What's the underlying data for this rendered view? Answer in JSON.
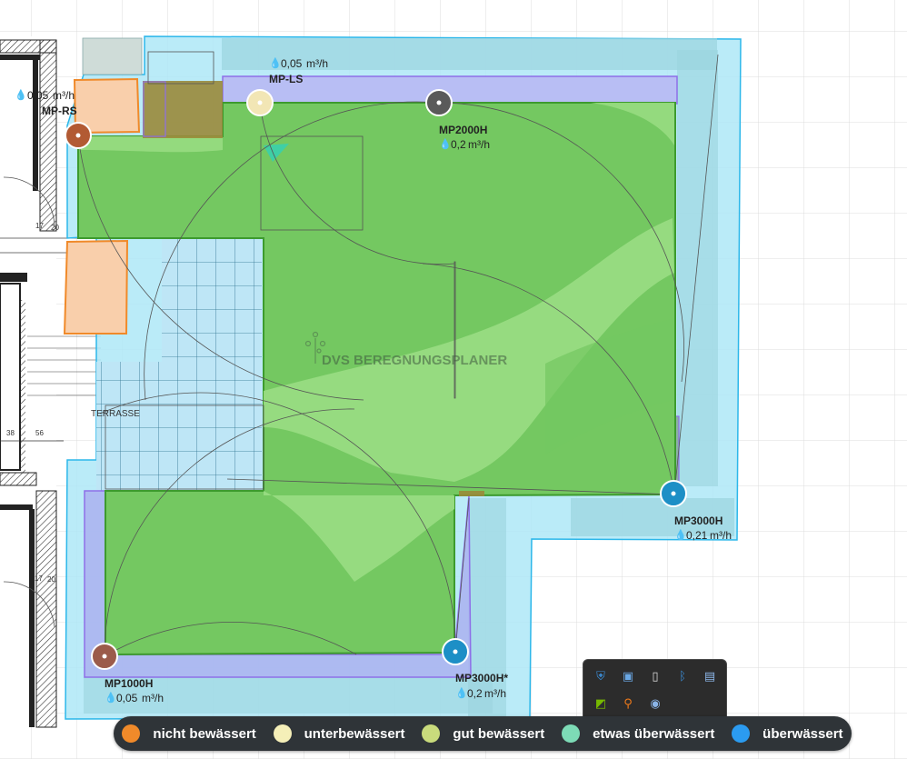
{
  "plan": {
    "watermark": "DVS BEREGNUNGSPLANER",
    "terrace_label": "TERRASSE",
    "dimension_labels": [
      "20",
      "17",
      "56",
      "38",
      "20",
      "17"
    ]
  },
  "sprinklers": [
    {
      "name": "MP-RS",
      "flow": "0,05",
      "unit": "m³/h",
      "color": "#b25a33"
    },
    {
      "name": "MP-LS",
      "flow": "0,05",
      "unit": "m³/h",
      "color": "#f2e6b5"
    },
    {
      "name": "MP2000H",
      "flow": "0,2",
      "unit": "m³/h",
      "color": "#5a5a5a"
    },
    {
      "name": "MP3000H",
      "flow": "0,21",
      "unit": "m³/h",
      "color": "#1d8fc6"
    },
    {
      "name": "MP3000H*",
      "flow": "0,2",
      "unit": "m³/h",
      "color": "#1d8fc6"
    },
    {
      "name": "MP1000H",
      "flow": "0,05",
      "unit": "m³/h",
      "color": "#9b5b4b"
    }
  ],
  "legend": [
    {
      "label": "nicht bewässert",
      "color": "#f08a2a"
    },
    {
      "label": "unterbewässert",
      "color": "#f5efb8"
    },
    {
      "label": "gut bewässert",
      "color": "#c9db7c"
    },
    {
      "label": "etwas überwässert",
      "color": "#7ddbb6"
    },
    {
      "label": "überwässert",
      "color": "#2b9bf0"
    }
  ],
  "tray": {
    "icons": [
      "warning-shield-icon",
      "network-icon",
      "usb-icon",
      "bluetooth-icon",
      "lock-icon",
      "nvidia-icon",
      "search-app-icon",
      "steam-icon"
    ]
  }
}
